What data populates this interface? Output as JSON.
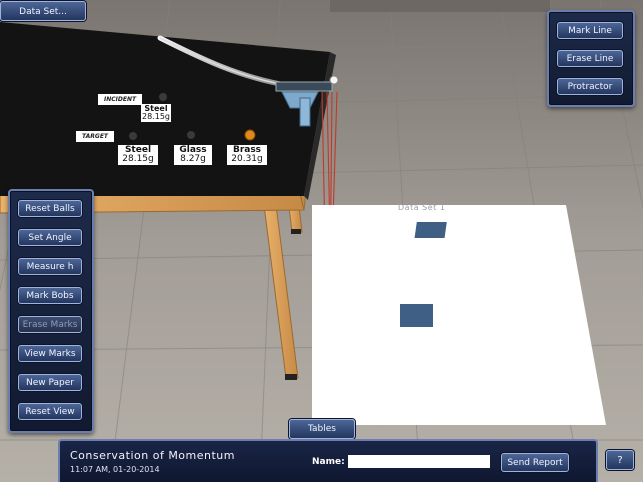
{
  "top": {
    "data_set_button": "Data Set..."
  },
  "right_panel": {
    "mark_line": "Mark Line",
    "erase_line": "Erase Line",
    "protractor": "Protractor"
  },
  "left_panel": {
    "reset_balls": "Reset Balls",
    "set_angle": "Set Angle",
    "measure_h": "Measure h",
    "mark_bobs": "Mark Bobs",
    "erase_marks": "Erase Marks",
    "view_marks": "View Marks",
    "new_paper": "New Paper",
    "reset_view": "Reset View"
  },
  "table_labels": {
    "incident": "INCIDENT",
    "target": "TARGET",
    "incident_steel_name": "Steel",
    "incident_steel_mass": "28.15g",
    "target_steel_name": "Steel",
    "target_steel_mass": "28.15g",
    "glass_name": "Glass",
    "glass_mass": "8.27g",
    "brass_name": "Brass",
    "brass_mass": "20.31g"
  },
  "paper": {
    "label": "Data Set 1"
  },
  "bottom_bar": {
    "tables_button": "Tables",
    "title": "Conservation of Momentum",
    "timestamp": "11:07 AM, 01-20-2014",
    "name_label": "Name:",
    "name_value": "",
    "send_report": "Send Report",
    "help": "?"
  },
  "colors": {
    "panel_bg": "#1a2546",
    "panel_border": "#6a7fb0",
    "tabletop": "#121212",
    "wood": "#d8a25e",
    "floor": "#9a9690",
    "paper": "#ffffff",
    "target_square": "#3f5f85",
    "string": "#c0392b",
    "brass_ball": "#e08a1e"
  }
}
